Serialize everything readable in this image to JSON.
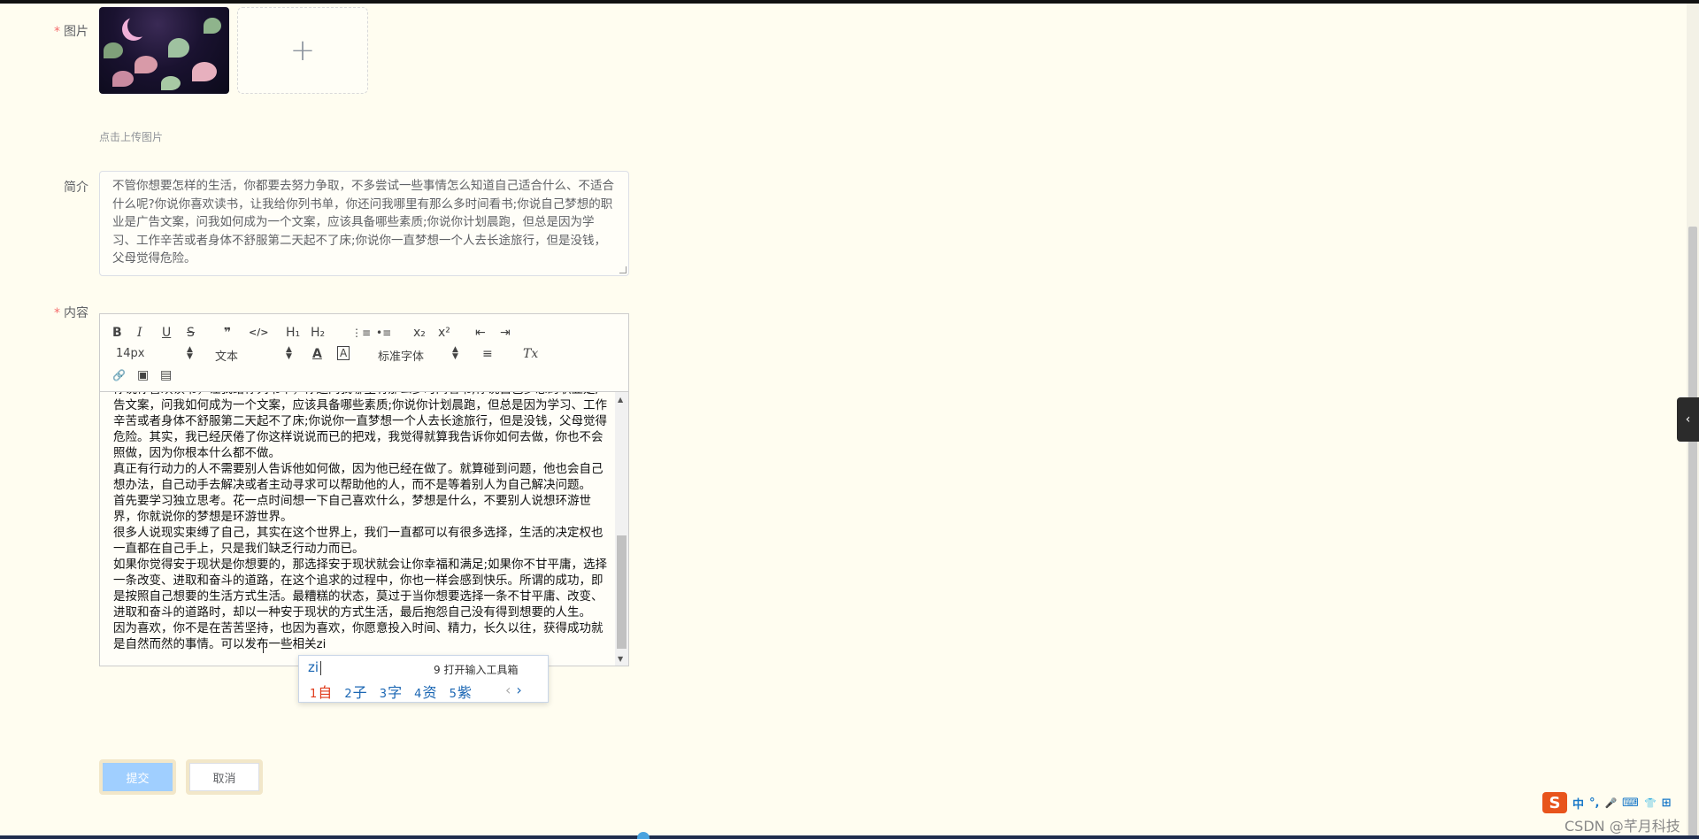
{
  "form": {
    "image_label": "图片",
    "image_required": "*",
    "upload_tip": "点击上传图片",
    "upload_plus": "+",
    "intro_label": "简介",
    "intro_text": "不管你想要怎样的生活，你都要去努力争取，不多尝试一些事情怎么知道自己适合什么、不适合什么呢?你说你喜欢读书，让我给你列书单，你还问我哪里有那么多时间看书;你说自己梦想的职业是广告文案，问我如何成为一个文案，应该具备哪些素质;你说你计划晨跑，但总是因为学习、工作辛苦或者身体不舒服第二天起不了床;你说你一直梦想一个人去长途旅行，但是没钱，父母觉得危险。",
    "content_label": "内容",
    "content_required": "*",
    "submit_label": "提交",
    "cancel_label": "取消"
  },
  "editor": {
    "toolbar": {
      "bold": "B",
      "italic": "I",
      "underline": "U",
      "strike": "S",
      "blockquote": "❞",
      "code": "</>",
      "h1": "H₁",
      "h2": "H₂",
      "ordered_list": "⋮≡",
      "bullet_list": "•≡",
      "subscript": "x₂",
      "superscript": "x²",
      "outdent": "⇤",
      "indent": "⇥",
      "size": "14px",
      "header": "文本",
      "font": "标准字体",
      "align": "≡",
      "clean": "Tx",
      "link": "🔗",
      "image": "▣",
      "video": "▤"
    },
    "paragraphs": [
      "你说你喜欢读书，让我给你列书单，你还问我哪里有那么多时间看书;你说自己梦想的职业是广告文案，问我如何成为一个文案，应该具备哪些素质;你说你计划晨跑，但总是因为学习、工作辛苦或者身体不舒服第二天起不了床;你说你一直梦想一个人去长途旅行，但是没钱，父母觉得危险。其实，我已经厌倦了你这样说说而已的把戏，我觉得就算我告诉你如何去做，你也不会照做，因为你根本什么都不做。",
      "真正有行动力的人不需要别人告诉他如何做，因为他已经在做了。就算碰到问题，他也会自己想办法，自己动手去解决或者主动寻求可以帮助他的人，而不是等着别人为自己解决问题。",
      "首先要学习独立思考。花一点时间想一下自己喜欢什么，梦想是什么，不要别人说想环游世界，你就说你的梦想是环游世界。",
      "很多人说现实束缚了自己，其实在这个世界上，我们一直都可以有很多选择，生活的决定权也一直都在自己手上，只是我们缺乏行动力而已。",
      "如果你觉得安于现状是你想要的，那选择安于现状就会让你幸福和满足;如果你不甘平庸，选择一条改变、进取和奋斗的道路，在这个追求的过程中，你也一样会感到快乐。所谓的成功，即是按照自己想要的生活方式生活。最糟糕的状态，莫过于当你想要选择一条不甘平庸、改变、进取和奋斗的道路时，却以一种安于现状的方式生活，最后抱怨自己没有得到想要的人生。",
      "因为喜欢，你不是在苦苦坚持，也因为喜欢，你愿意投入时间、精力，长久以往，获得成功就是自然而然的事情。可以发布一些相关zi"
    ]
  },
  "ime": {
    "pinyin": "zi",
    "toolbox_tip": "9 打开输入工具箱",
    "candidates": [
      {
        "n": "1",
        "c": "自"
      },
      {
        "n": "2",
        "c": "子"
      },
      {
        "n": "3",
        "c": "字"
      },
      {
        "n": "4",
        "c": "资"
      },
      {
        "n": "5",
        "c": "紫"
      }
    ],
    "prev": "‹",
    "next": "›"
  },
  "tray": {
    "logo": "S",
    "lang": "中",
    "punct": "°,",
    "mic": "🎤",
    "keyboard": "⌨",
    "skin": "👕",
    "apps": "⊞"
  },
  "watermark": "CSDN @芊月科技",
  "side_tab": "‹"
}
